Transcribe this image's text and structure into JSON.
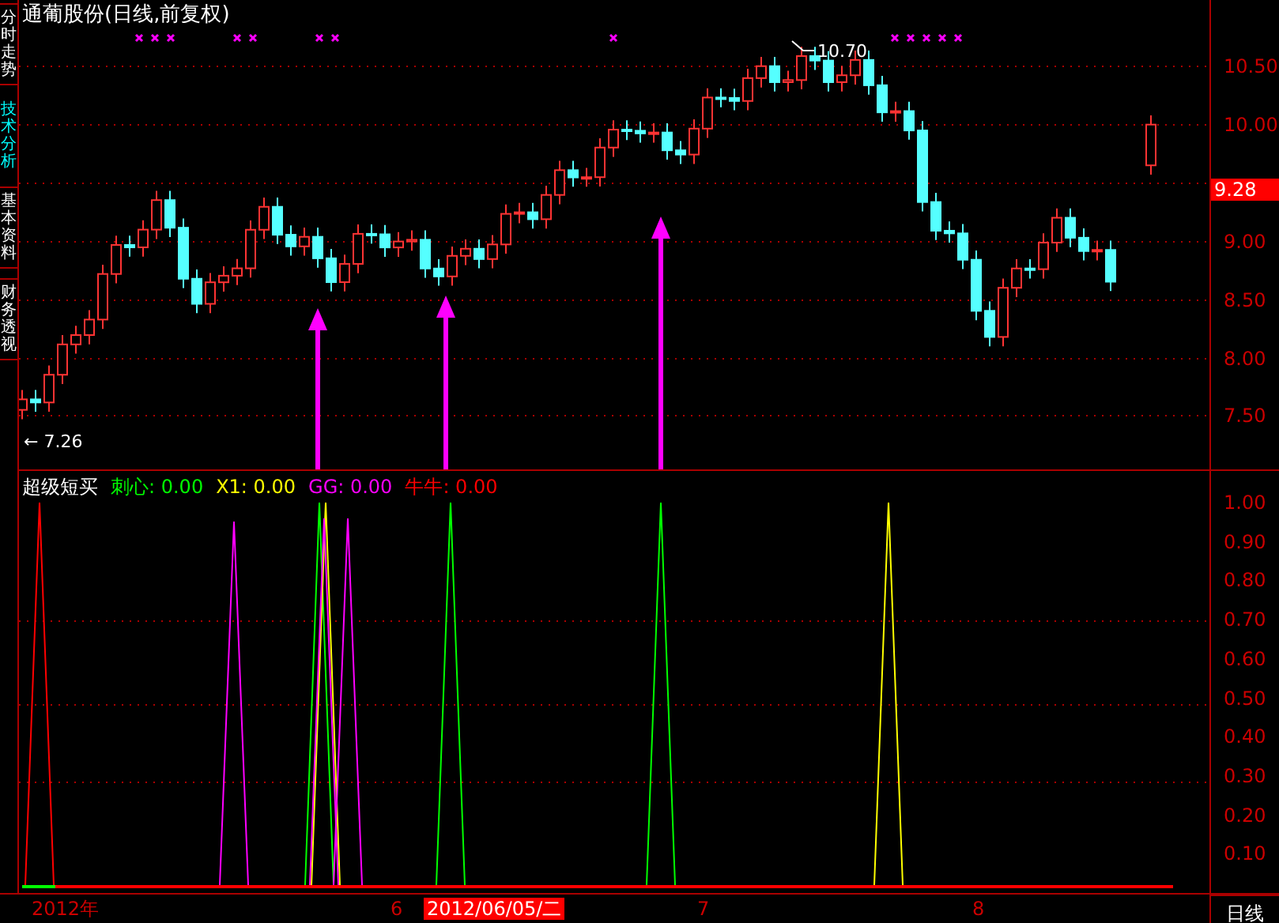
{
  "chart_title": "通葡股份(日线,前复权)",
  "sidebar": {
    "tabs": [
      {
        "label": "分时走势",
        "selected": false
      },
      {
        "label": "技术分析",
        "selected": true
      },
      {
        "label": "基本资料",
        "selected": false
      },
      {
        "label": "财务透视",
        "selected": false
      }
    ]
  },
  "price_panel": {
    "axis_labels": [
      "10.50",
      "10.00",
      "9.00",
      "8.50",
      "8.00",
      "7.50"
    ],
    "current_price": "9.28",
    "high_label": "10.70",
    "low_label": "← 7.26"
  },
  "indicator_panel": {
    "name": "超级短买",
    "series": [
      {
        "label": "刺心: 0.00",
        "color": "#00ff00"
      },
      {
        "label": "X1: 0.00",
        "color": "#ffff00"
      },
      {
        "label": "GG: 0.00",
        "color": "#ff00ff"
      },
      {
        "label": "牛牛: 0.00",
        "color": "#ff0000"
      }
    ],
    "axis_labels": [
      "1.00",
      "0.90",
      "0.80",
      "0.70",
      "0.60",
      "0.50",
      "0.40",
      "0.30",
      "0.20",
      "0.10"
    ]
  },
  "time_axis": {
    "labels": [
      "2012年",
      "6",
      "7",
      "8"
    ],
    "cursor_date": "2012/06/05/二"
  },
  "period": "日线"
}
